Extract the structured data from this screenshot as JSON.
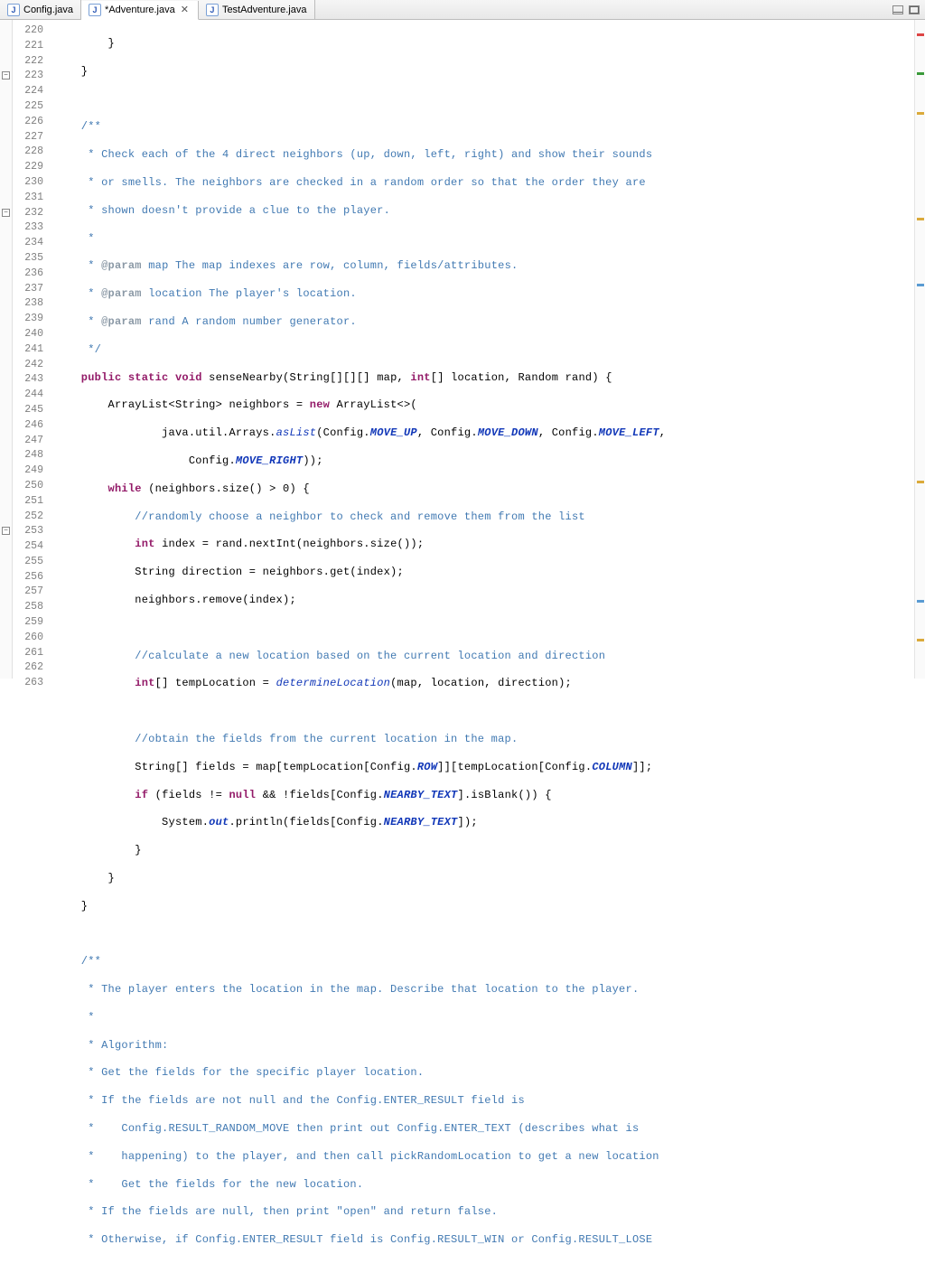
{
  "tabs": [
    {
      "label": "Config.java",
      "active": false,
      "dirty": false
    },
    {
      "label": "*Adventure.java",
      "active": true,
      "dirty": true
    },
    {
      "label": "TestAdventure.java",
      "active": false,
      "dirty": false
    }
  ],
  "gutter": {
    "start": 220,
    "end": 263,
    "fold_lines": [
      223,
      232,
      253
    ]
  },
  "overview": [
    {
      "pos": 2,
      "cls": "ov-red"
    },
    {
      "pos": 8,
      "cls": "ov-grn"
    },
    {
      "pos": 14,
      "cls": "ov-yel"
    },
    {
      "pos": 30,
      "cls": "ov-yel"
    },
    {
      "pos": 40,
      "cls": "ov-blu"
    },
    {
      "pos": 70,
      "cls": "ov-yel"
    },
    {
      "pos": 88,
      "cls": "ov-blu"
    },
    {
      "pos": 94,
      "cls": "ov-yel"
    }
  ],
  "code": {
    "220": "        }",
    "221": "    }",
    "222": "",
    "223": "    /**",
    "224": "     * Check each of the 4 direct neighbors (up, down, left, right) and show their sounds",
    "225": "     * or smells. The neighbors are checked in a random order so that the order they are",
    "226": "     * shown doesn't provide a clue to the player.",
    "227": "     *",
    "228_pre": "     * ",
    "228_tag": "@param",
    "228_post": " map The map indexes are row, column, fields/attributes.",
    "229_pre": "     * ",
    "229_tag": "@param",
    "229_post": " location The player's location.",
    "230_pre": "     * ",
    "230_tag": "@param",
    "230_post": " rand A random number generator.",
    "231": "     */",
    "232_kw1": "public static void",
    "232_m": " senseNearby(String[][][] ",
    "232_p1": "map",
    "232_c1": ", ",
    "232_kw2": "int",
    "232_p2": "[] ",
    "232_p2b": "location",
    "232_c2": ", Random ",
    "232_p3": "rand",
    "232_end": ") {",
    "233_a": "        ArrayList<String> neighbors = ",
    "233_kw": "new",
    "233_b": " ArrayList<>(",
    "234_a": "                java.util.Arrays.",
    "234_m": "asList",
    "234_b": "(Config.",
    "234_f1": "MOVE_UP",
    "234_c": ", Config.",
    "234_f2": "MOVE_DOWN",
    "234_d": ", Config.",
    "234_f3": "MOVE_LEFT",
    "234_e": ",",
    "235_a": "                    Config.",
    "235_f": "MOVE_RIGHT",
    "235_b": "));",
    "236_a": "        ",
    "236_kw": "while",
    "236_b": " (neighbors.size() > 0) {",
    "237": "            //randomly choose a neighbor to check and remove them from the list",
    "238_a": "            ",
    "238_kw": "int",
    "238_b": " index = rand.nextInt(neighbors.size());",
    "239": "            String direction = neighbors.get(index);",
    "240": "            neighbors.remove(index);",
    "241": "",
    "242": "            //calculate a new location based on the current location and direction",
    "243_a": "            ",
    "243_kw": "int",
    "243_b": "[] tempLocation = ",
    "243_m": "determineLocation",
    "243_c": "(map, location, direction);",
    "244": "",
    "245": "            //obtain the fields from the current location in the map.",
    "246_a": "            String[] fields = map[tempLocation[Config.",
    "246_f1": "ROW",
    "246_b": "]][tempLocation[Config.",
    "246_f2": "COLUMN",
    "246_c": "]];",
    "247_a": "            ",
    "247_kw": "if",
    "247_b": " (fields != ",
    "247_kw2": "null",
    "247_c": " && !fields[Config.",
    "247_f": "NEARBY_TEXT",
    "247_d": "].isBlank()) {",
    "248_a": "                System.",
    "248_f": "out",
    "248_b": ".println(fields[Config.",
    "248_f2": "NEARBY_TEXT",
    "248_c": "]);",
    "249": "            }",
    "250": "        }",
    "251": "    }",
    "252": "",
    "253": "    /**",
    "254": "     * The player enters the location in the map. Describe that location to the player.",
    "255": "     *",
    "256": "     * Algorithm:",
    "257": "     * Get the fields for the specific player location.",
    "258": "     * If the fields are not null and the Config.ENTER_RESULT field is",
    "259": "     *    Config.RESULT_RANDOM_MOVE then print out Config.ENTER_TEXT (describes what is",
    "260": "     *    happening) to the player, and then call pickRandomLocation to get a new location",
    "261": "     *    Get the fields for the new location.",
    "262": "     * If the fields are null, then print \"open\" and return false.",
    "263": "     * Otherwise, if Config.ENTER_RESULT field is Config.RESULT_WIN or Config.RESULT_LOSE"
  }
}
